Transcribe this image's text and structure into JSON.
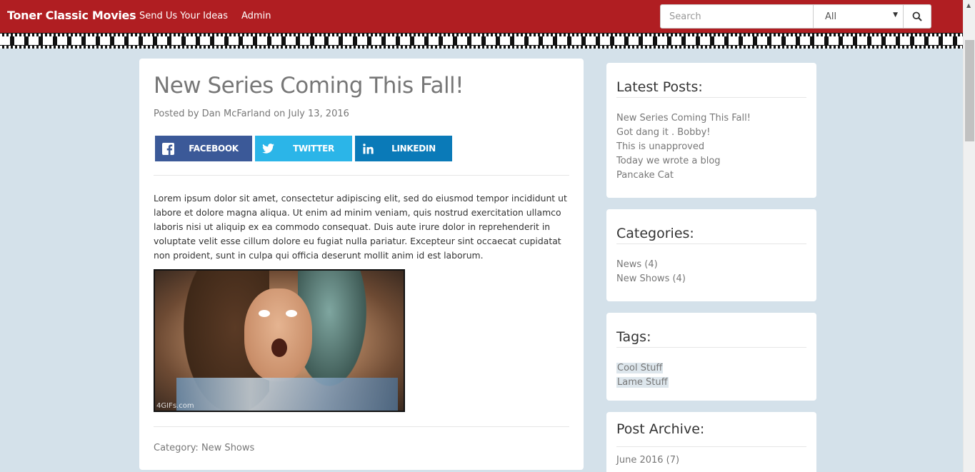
{
  "navbar": {
    "brand": "Toner Classic Movies",
    "links": [
      "Send Us Your Ideas",
      "Admin"
    ],
    "search_placeholder": "Search",
    "filter_selected": "All",
    "color": "#b01e22"
  },
  "post": {
    "title": "New Series Coming This Fall!",
    "meta": "Posted by Dan McFarland on July 13, 2016",
    "share": {
      "facebook": "FACEBOOK",
      "twitter": "TWITTER",
      "linkedin": "LINKEDIN"
    },
    "body": "Lorem ipsum dolor sit amet, consectetur adipiscing elit, sed do eiusmod tempor incididunt ut labore et dolore magna aliqua. Ut enim ad minim veniam, quis nostrud exercitation ullamco laboris nisi ut aliquip ex ea commodo consequat. Duis aute irure dolor in reprehenderit in voluptate velit esse cillum dolore eu fugiat nulla pariatur. Excepteur sint occaecat cupidatat non proident, sunt in culpa qui officia deserunt mollit anim id est laborum.",
    "image_watermark": "4GIFs.com",
    "category": "Category: New Shows"
  },
  "sidebar": {
    "latest": {
      "title": "Latest Posts:",
      "items": [
        "New Series Coming This Fall!",
        "Got dang it . Bobby!",
        "This is unapproved",
        "Today we wrote a blog",
        "Pancake Cat"
      ]
    },
    "categories": {
      "title": "Categories:",
      "items": [
        "News (4)",
        "New Shows (4)"
      ]
    },
    "tags": {
      "title": "Tags:",
      "items": [
        "Cool Stuff",
        "Lame Stuff"
      ]
    },
    "archive": {
      "title": "Post Archive:",
      "items": [
        "June 2016 (7)"
      ]
    }
  }
}
